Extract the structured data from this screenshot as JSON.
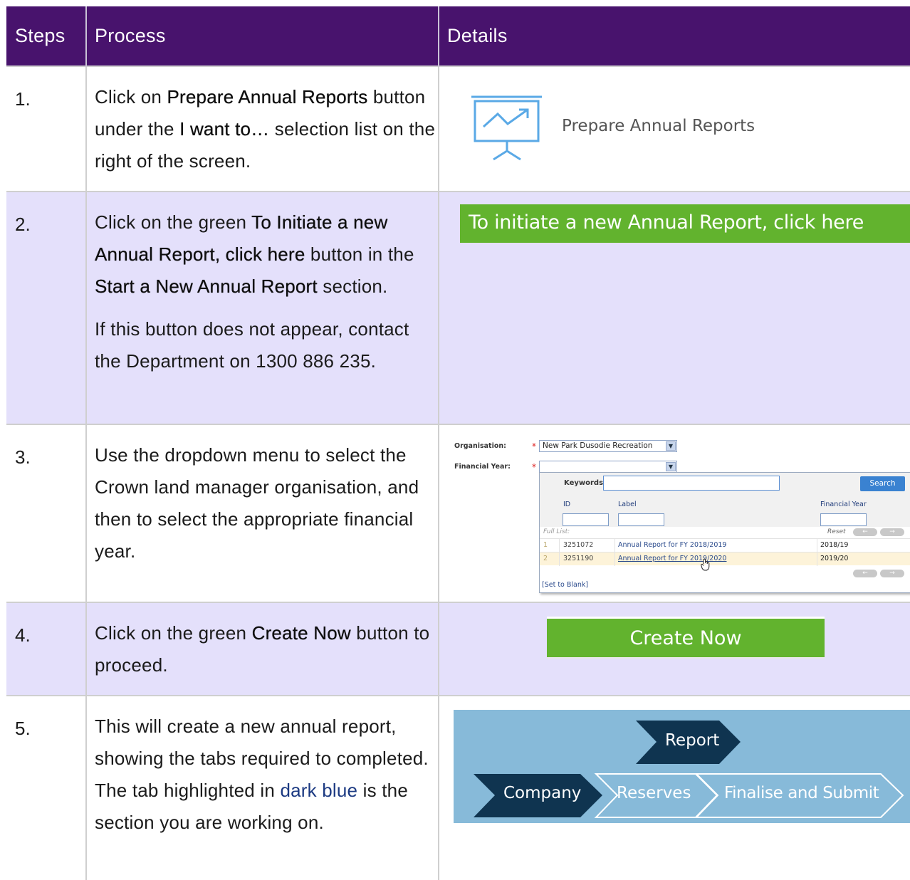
{
  "headers": {
    "steps": "Steps",
    "process": "Process",
    "details": "Details"
  },
  "rows": [
    {
      "step": "1.",
      "process_html": [
        "Click on ",
        {
          "b": "Prepare Annual Reports"
        },
        " button under the ",
        {
          "b": "I want to…"
        },
        " selection list on the right of the screen."
      ],
      "detail": {
        "label": "Prepare Annual Reports",
        "icon": "presentation-chart-icon"
      }
    },
    {
      "step": "2.",
      "p1": [
        "Click on the green ",
        {
          "b": "To Initiate a new Annual Report, click here"
        },
        " button in the ",
        {
          "b": "Start a New Annual Report"
        },
        " section."
      ],
      "p2": "If this button does not appear, contact the Department on 1300 886 235.",
      "detail": {
        "button": "To initiate a new Annual Report, click here"
      }
    },
    {
      "step": "3.",
      "process": "Use the dropdown menu to select the Crown land manager organisation, and then to select the appropriate financial year.",
      "detail": {
        "organisation_label": "Organisation:",
        "organisation_value": "New Park Dusodie Recreation",
        "fy_label": "Financial Year:",
        "required": "*",
        "keywords_label": "Keywords:",
        "search_button": "Search",
        "columns": [
          "ID",
          "Label",
          "Financial Year"
        ],
        "full_list": "Full List:",
        "reset": "Reset",
        "results": [
          {
            "n": "1",
            "id": "3251072",
            "label": "Annual Report for FY 2018/2019",
            "fy": "2018/19"
          },
          {
            "n": "2",
            "id": "3251190",
            "label": "Annual Report for FY 2019/2020",
            "fy": "2019/20"
          }
        ],
        "set_to_blank": "[Set to Blank]"
      }
    },
    {
      "step": "4.",
      "process_html": [
        "Click on the green ",
        {
          "b": "Create Now"
        },
        " button to proceed."
      ],
      "detail": {
        "button": "Create Now"
      }
    },
    {
      "step": "5.",
      "process_html": [
        "This will create a new annual report, showing the tabs required to completed. The tab highlighted in ",
        {
          "blue": "dark blue"
        },
        " is the section you are working on."
      ],
      "detail": {
        "tabs_top": "Report",
        "tabs": [
          "Company",
          "Reserves",
          "Finalise and Submit"
        ]
      }
    }
  ],
  "colors": {
    "header_bg": "#48136d",
    "alt_row": "#e4e0fb",
    "green": "#62b32e",
    "dark_tab": "#0f3450",
    "tab_bg": "#87bad9"
  }
}
